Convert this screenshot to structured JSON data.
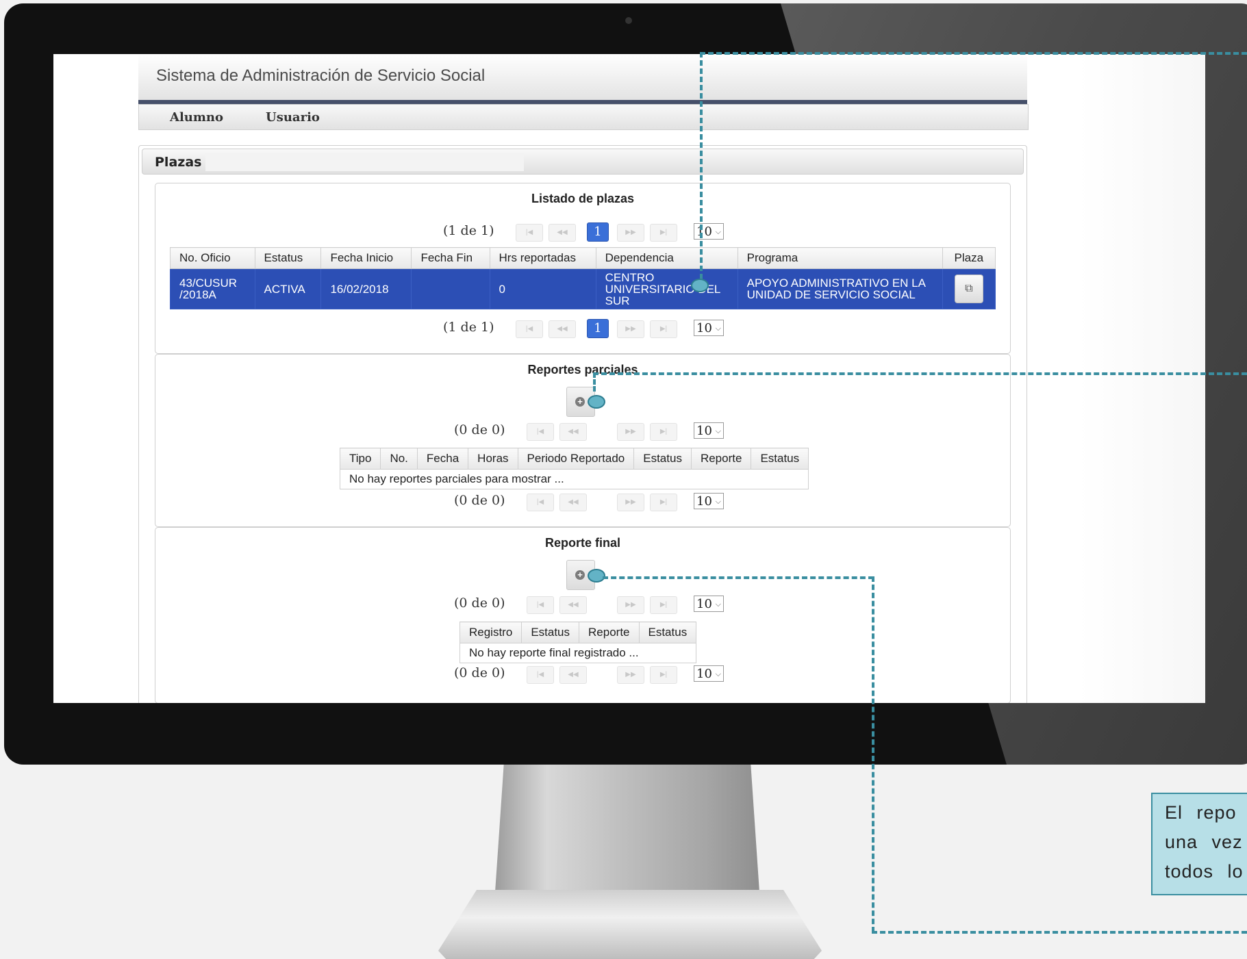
{
  "app": {
    "title": "Sistema de Administración de Servicio Social"
  },
  "menu": {
    "items": [
      "Alumno",
      "Usuario"
    ]
  },
  "panel": {
    "title": "Plazas"
  },
  "listado": {
    "title": "Listado de plazas",
    "pager_text": "(1 de 1)",
    "current_page": "1",
    "rows_per_page": "10",
    "columns": [
      "No. Oficio",
      "Estatus",
      "Fecha Inicio",
      "Fecha Fin",
      "Hrs reportadas",
      "Dependencia",
      "Programa",
      "Plaza"
    ],
    "row": {
      "oficio": [
        "43/CUSUR",
        "/2018A"
      ],
      "estatus": "ACTIVA",
      "fecha_inicio": "16/02/2018",
      "fecha_fin": "",
      "hrs": "0",
      "dependencia": [
        "CENTRO",
        "UNIVERSITARIO DEL",
        "SUR"
      ],
      "programa": [
        "APOYO ADMINISTRATIVO EN LA",
        "UNIDAD DE SERVICIO SOCIAL"
      ]
    }
  },
  "parciales": {
    "title": "Reportes parciales",
    "pager_text": "(0 de 0)",
    "rows_per_page": "10",
    "columns": [
      "Tipo",
      "No.",
      "Fecha",
      "Horas",
      "Periodo Reportado",
      "Estatus",
      "Reporte",
      "Estatus"
    ],
    "empty": "No hay reportes parciales para mostrar ..."
  },
  "final": {
    "title": "Reporte final",
    "pager_text": "(0 de 0)",
    "rows_per_page": "10",
    "columns": [
      "Registro",
      "Estatus",
      "Reporte",
      "Estatus"
    ],
    "empty": "No hay reporte final registrado ..."
  },
  "callout": {
    "lines": [
      "El repo",
      "una vez",
      "todos lo"
    ]
  },
  "colors": {
    "annotation": "#3a8ea0",
    "selected_row": "#2c4fb5",
    "header_rule": "#46506a"
  }
}
